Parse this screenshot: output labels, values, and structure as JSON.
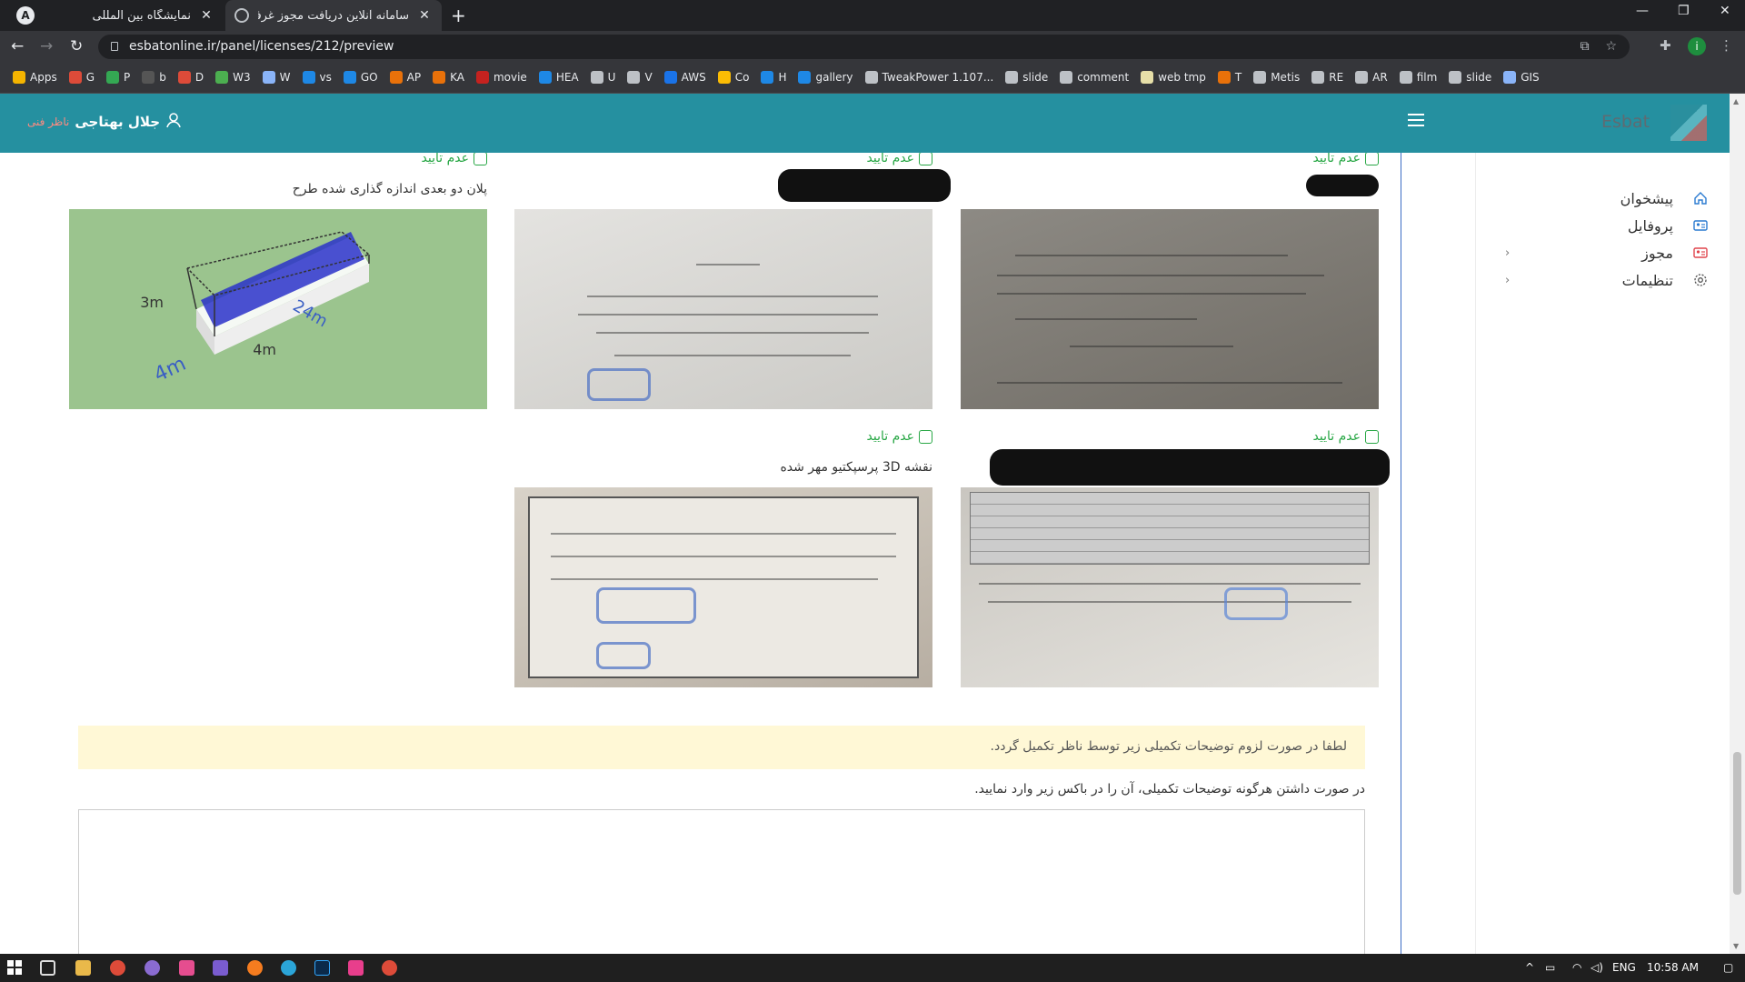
{
  "browser": {
    "tabs": [
      {
        "title": "نمایشگاه بین المللی تهران",
        "active": false
      },
      {
        "title": "سامانه آنلاین دریافت مجوز غرفه سا",
        "active": true
      }
    ],
    "url": "esbatonline.ir/panel/licenses/212/preview",
    "profile_initial": "i",
    "app_badge": "A",
    "bookmarks": [
      "Apps",
      "G",
      "P",
      "b",
      "D",
      "W3",
      "W",
      "vs",
      "GO",
      "AP",
      "KA",
      "movie",
      "HEA",
      "U",
      "V",
      "AWS",
      "Co",
      "H",
      "gallery",
      "TweakPower 1.107...",
      "slide",
      "comment",
      "web tmp",
      "T",
      "Metis",
      "RE",
      "AR",
      "film",
      "slide",
      "GIS"
    ]
  },
  "header": {
    "user_name": "جلال بهتاجی",
    "user_role": "ناظر فنی",
    "brand": "Esbat"
  },
  "sidebar": {
    "items": [
      {
        "label": "پیشخوان",
        "icon": "home-icon",
        "has_children": false
      },
      {
        "label": "پروفایل",
        "icon": "profile-card-icon",
        "has_children": false
      },
      {
        "label": "مجوز",
        "icon": "license-card-icon",
        "has_children": true
      },
      {
        "label": "تنظیمات",
        "icon": "gear-icon",
        "has_children": true
      }
    ]
  },
  "documents": {
    "reject_label": "عدم تایید",
    "row1": [
      {
        "caption": "",
        "redacted": true
      },
      {
        "caption": "",
        "redacted": true
      },
      {
        "caption": "پلان دو بعدی اندازه گذاری شده طرح",
        "redacted": false
      }
    ],
    "row2": [
      {
        "caption": "",
        "redacted": true
      },
      {
        "caption": "نقشه 3D پرسپکتیو مهر شده",
        "redacted": false
      }
    ],
    "plan_dims": {
      "height": "3m",
      "length": "24m",
      "width": "4m",
      "depth": "4m"
    }
  },
  "notice": "لطفا در صورت لزوم توضیحات تکمیلی زیر توسط ناظر تکمیل گردد.",
  "description_label": "در صورت داشتن هرگونه توضیحات تکمیلی، آن را در باکس زیر وارد نمایید.",
  "taskbar": {
    "lang": "ENG",
    "time": "10:58 AM"
  }
}
